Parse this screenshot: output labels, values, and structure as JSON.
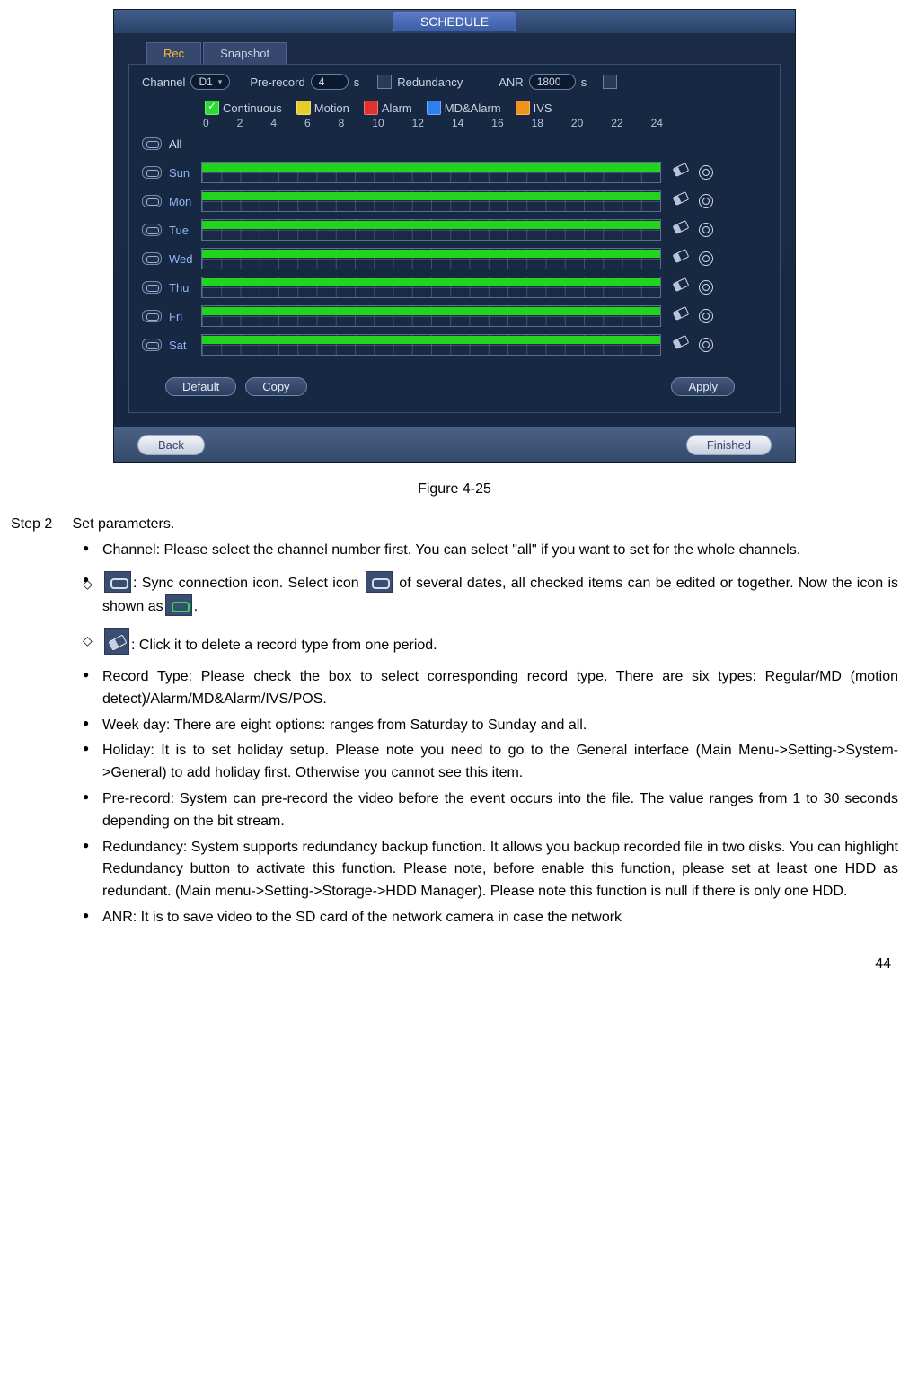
{
  "app": {
    "title": "SCHEDULE",
    "tabs": {
      "rec": "Rec",
      "snapshot": "Snapshot",
      "active": "rec"
    },
    "settings": {
      "channel_label": "Channel",
      "channel_value": "D1",
      "prerecord_label": "Pre-record",
      "prerecord_value": "4",
      "prerecord_unit": "s",
      "redundancy_label": "Redundancy",
      "anr_label": "ANR",
      "anr_value": "1800",
      "anr_unit": "s"
    },
    "legend": {
      "continuous": "Continuous",
      "motion": "Motion",
      "alarm": "Alarm",
      "mdalarm": "MD&Alarm",
      "ivs": "IVS"
    },
    "ticks": [
      "0",
      "2",
      "4",
      "6",
      "8",
      "10",
      "12",
      "14",
      "16",
      "18",
      "20",
      "22",
      "24"
    ],
    "days": {
      "all": "All",
      "list": [
        "Sun",
        "Mon",
        "Tue",
        "Wed",
        "Thu",
        "Fri",
        "Sat"
      ]
    },
    "buttons": {
      "default": "Default",
      "copy": "Copy",
      "apply": "Apply"
    },
    "bottom": {
      "back": "Back",
      "finished": "Finished"
    }
  },
  "figure_caption": "Figure 4-25",
  "doc": {
    "step_label": "Step 2",
    "step_title": "Set parameters.",
    "b1": "Channel: Please select the channel number first. You can select \"all\" if you want to set for the whole channels.",
    "d1a": ": Sync connection icon. Select icon ",
    "d1b": " of several dates, all checked items can be edited or together. Now the icon is shown as",
    "d1c": ".",
    "d2": ": Click it to delete a record type from one period.",
    "b2": "Record Type: Please check the box to select corresponding record type. There are six types: Regular/MD (motion detect)/Alarm/MD&Alarm/IVS/POS.",
    "b3": "Week day: There are eight options: ranges from Saturday to Sunday and all.",
    "b4": "Holiday: It is to set holiday setup. Please note you need to go to the General interface (Main Menu->Setting->System->General) to add holiday first. Otherwise you cannot see this item.",
    "b5": "Pre-record: System can pre-record the video before the event occurs into the file. The value ranges from 1 to 30 seconds depending on the bit stream.",
    "b6": "Redundancy: System supports redundancy backup function. It allows you backup recorded file in two disks. You can highlight Redundancy button to activate this function. Please note, before enable this function, please set at least one HDD as redundant. (Main menu->Setting->Storage->HDD Manager). Please note this function is null if there is only one HDD.",
    "b7": "ANR: It is to save video to the SD card of the network camera in case the network"
  },
  "page_number": "44"
}
